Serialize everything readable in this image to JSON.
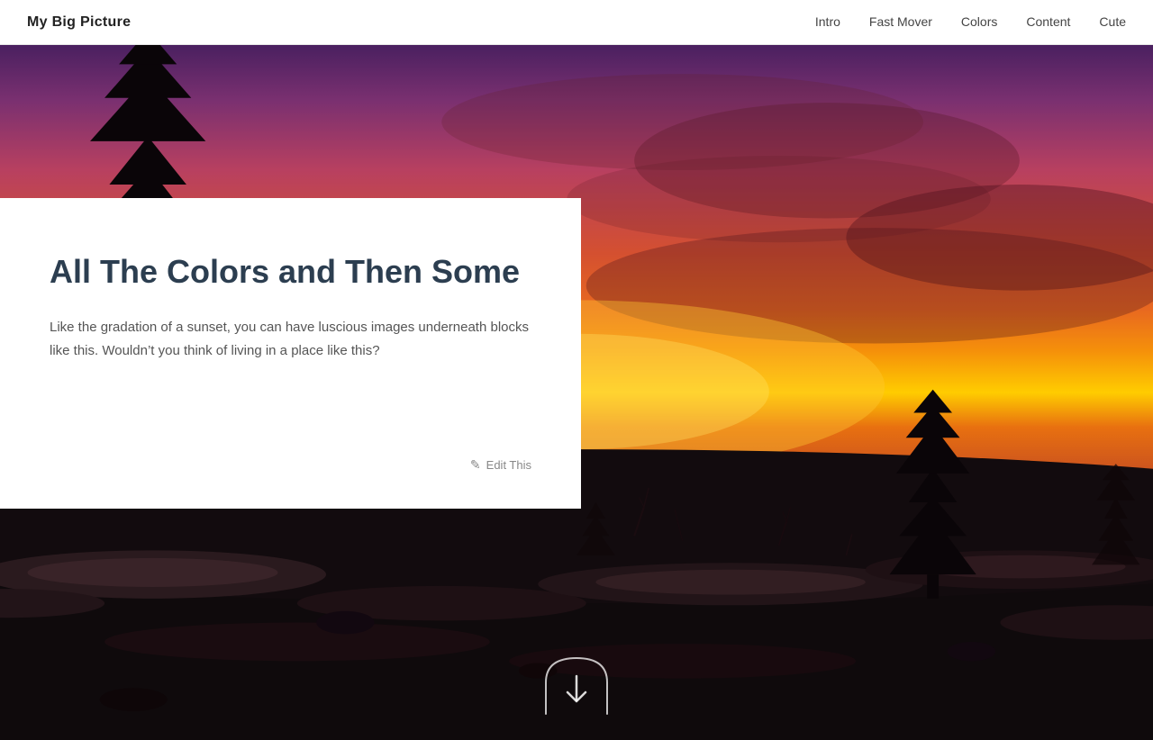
{
  "site": {
    "title": "My Big Picture"
  },
  "navbar": {
    "links": [
      {
        "label": "Intro",
        "href": "#intro"
      },
      {
        "label": "Fast Mover",
        "href": "#fast-mover"
      },
      {
        "label": "Colors",
        "href": "#colors"
      },
      {
        "label": "Content",
        "href": "#content"
      },
      {
        "label": "Cute",
        "href": "#cute"
      }
    ]
  },
  "hero": {
    "card": {
      "heading": "All The Colors and Then Some",
      "body": "Like the gradation of a sunset, you can have luscious images underneath blocks like this. Wouldn’t you think of living in a place like this?",
      "edit_label": "Edit This"
    }
  }
}
